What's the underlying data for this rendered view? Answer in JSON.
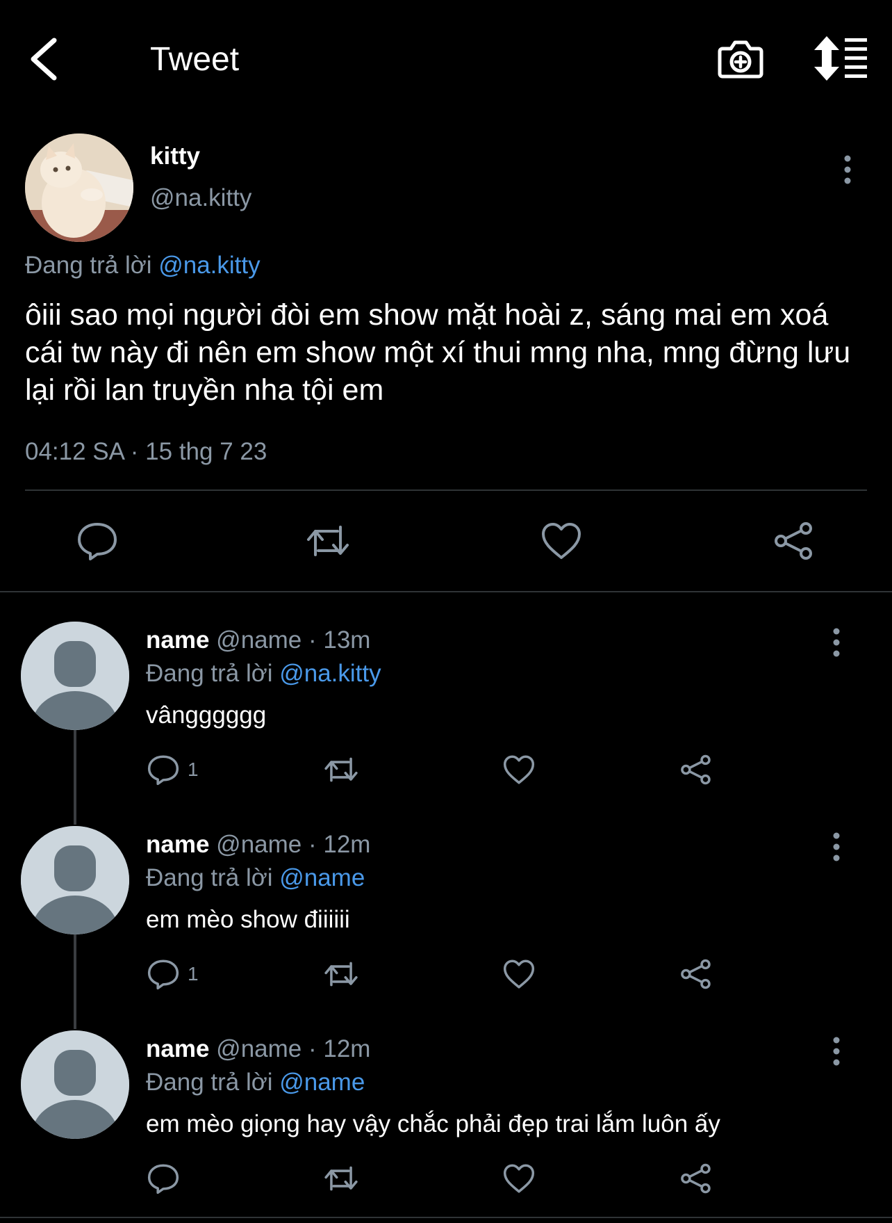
{
  "header": {
    "title": "Tweet",
    "back_icon": "chevron-left-icon",
    "camera_icon": "camera-plus-icon",
    "sort_icon": "sort-list-icon"
  },
  "tweet": {
    "author_name": "kitty",
    "author_handle": "@na.kitty",
    "replying_label": "Đang trả lời",
    "replying_to": "@na.kitty",
    "text": "ôiii sao mọi người đòi em show mặt hoài z, sáng mai em xoá cái tw này đi nên em show một xí thui mng nha, mng đừng lưu lại rồi lan truyền nha tội em",
    "timestamp": "04:12 SA · 15 thg 7 23"
  },
  "replies": [
    {
      "name": "name",
      "handle": "@name",
      "time": "· 13m",
      "replying_label": "Đang trả lời",
      "replying_to": "@na.kitty",
      "text": "vângggggg",
      "reply_count": "1"
    },
    {
      "name": "name",
      "handle": "@name",
      "time": "· 12m",
      "replying_label": "Đang trả lời",
      "replying_to": "@name",
      "text": "em mèo show điiiiii",
      "reply_count": "1"
    },
    {
      "name": "name",
      "handle": "@name",
      "time": "· 12m",
      "replying_label": "Đang trả lời",
      "replying_to": "@name",
      "text": "em mèo giọng hay vậy chắc phải đẹp trai lắm luôn ấy",
      "reply_count": ""
    }
  ],
  "colors": {
    "background": "#000000",
    "text": "#ffffff",
    "secondary_text": "#8b98a5",
    "link": "#4a99e9",
    "divider": "#2f3336"
  }
}
